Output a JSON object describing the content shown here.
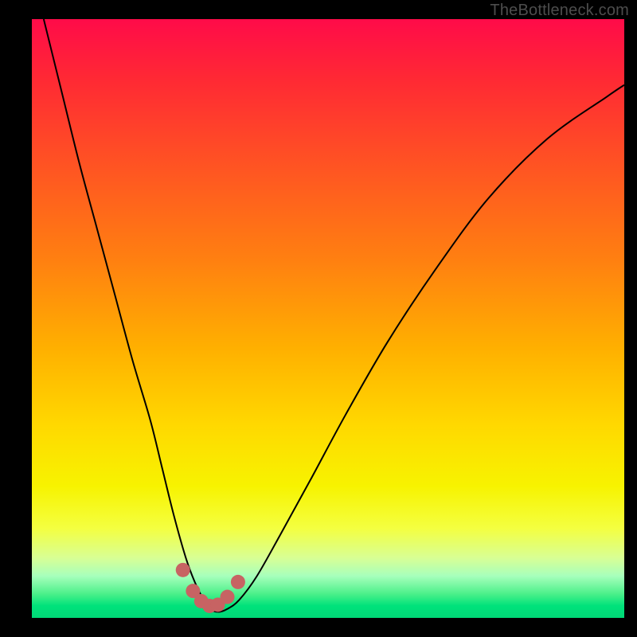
{
  "watermark": "TheBottleneck.com",
  "chart_data": {
    "type": "line",
    "title": "",
    "xlabel": "",
    "ylabel": "",
    "xlim": [
      0,
      100
    ],
    "ylim": [
      0,
      100
    ],
    "background_gradient": {
      "stops": [
        {
          "pos": 0,
          "color": "#ff0b49"
        },
        {
          "pos": 10,
          "color": "#ff2934"
        },
        {
          "pos": 25,
          "color": "#ff5522"
        },
        {
          "pos": 40,
          "color": "#ff7f11"
        },
        {
          "pos": 55,
          "color": "#ffb000"
        },
        {
          "pos": 68,
          "color": "#ffd900"
        },
        {
          "pos": 78,
          "color": "#f7f300"
        },
        {
          "pos": 85,
          "color": "#f4ff40"
        },
        {
          "pos": 90,
          "color": "#d8ff95"
        },
        {
          "pos": 93,
          "color": "#a7ffbc"
        },
        {
          "pos": 96,
          "color": "#4bf08a"
        },
        {
          "pos": 98,
          "color": "#00e27b"
        },
        {
          "pos": 100,
          "color": "#00d876"
        }
      ]
    },
    "series": [
      {
        "name": "bottleneck-curve",
        "x": [
          2,
          5,
          8,
          11,
          14,
          17,
          20,
          22,
          24,
          26,
          27.5,
          29,
          30,
          31.5,
          33,
          35,
          38,
          42,
          47,
          53,
          60,
          68,
          77,
          87,
          97,
          100
        ],
        "y": [
          100,
          88,
          76,
          65,
          54,
          43,
          33,
          25,
          17,
          10,
          6,
          3,
          1.5,
          1,
          1.5,
          3,
          7,
          14,
          23,
          34,
          46,
          58,
          70,
          80,
          87,
          89
        ]
      }
    ],
    "markers": [
      {
        "x": 25.5,
        "y": 8.0,
        "color": "#c76363"
      },
      {
        "x": 27.2,
        "y": 4.5,
        "color": "#c76363"
      },
      {
        "x": 28.6,
        "y": 2.8,
        "color": "#c76363"
      },
      {
        "x": 30.0,
        "y": 2.0,
        "color": "#c76363"
      },
      {
        "x": 31.4,
        "y": 2.2,
        "color": "#c76363"
      },
      {
        "x": 33.0,
        "y": 3.5,
        "color": "#c76363"
      },
      {
        "x": 34.8,
        "y": 6.0,
        "color": "#c76363"
      }
    ]
  }
}
